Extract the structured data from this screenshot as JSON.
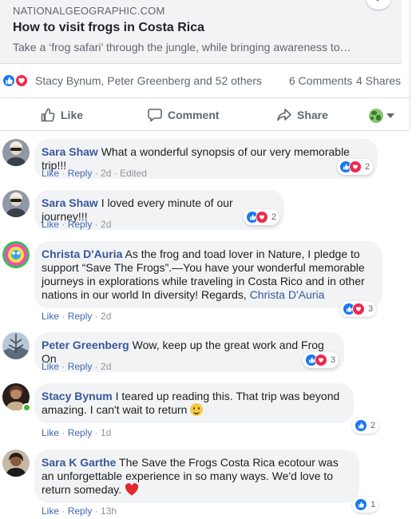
{
  "link_preview": {
    "domain": "NATIONALGEOGRAPHIC.COM",
    "title": "How to visit frogs in Costa Rica",
    "description": "Take a ‘frog safari’ through the jungle, while bringing awareness to…"
  },
  "reactions_summary": {
    "names": "Stacy Bynum, Peter Greenberg and 52 others",
    "comments": "6 Comments",
    "shares": "4 Shares",
    "icons": [
      "like-icon",
      "love-icon"
    ]
  },
  "actions": {
    "like": "Like",
    "comment": "Comment",
    "share": "Share"
  },
  "comments": [
    {
      "name": "Sara Shaw",
      "text": "What a wonderful synopsis of our very memorable trip!!!",
      "like": "Like",
      "reply": "Reply",
      "time": "2d",
      "edited": "Edited",
      "reaction_count": "2",
      "reactions": [
        "like",
        "love"
      ]
    },
    {
      "name": "Sara Shaw",
      "text": "I loved every minute of our journey!!!",
      "like": "Like",
      "reply": "Reply",
      "time": "2d",
      "reaction_count": "2",
      "reactions": [
        "like",
        "love"
      ]
    },
    {
      "name": "Christa D'Auria",
      "text": "As the frog and toad lover in Nature, I pledge to support “Save The Frogs”.—You have your wonderful memorable journeys in explorations while traveling in Costa Rico and in other nations in our world In diversity! Regards,",
      "mention": "Christa D'Auria",
      "like": "Like",
      "reply": "Reply",
      "time": "2d",
      "reaction_count": "3",
      "reactions": [
        "like",
        "love"
      ]
    },
    {
      "name": "Peter Greenberg",
      "text": "Wow, keep up the great work and Frog On",
      "like": "Like",
      "reply": "Reply",
      "time": "2d",
      "reaction_count": "3",
      "reactions": [
        "like",
        "love"
      ]
    },
    {
      "name": "Stacy Bynum",
      "text": "I teared up reading this. That trip was beyond amazing. I can't wait to return",
      "emoji": "smile",
      "like": "Like",
      "reply": "Reply",
      "time": "1d",
      "reaction_count": "2",
      "reactions": [
        "like"
      ]
    },
    {
      "name": "Sara K Garthe",
      "text": "The Save the Frogs Costa Rica ecotour was an unforgettable experience in so many ways. We'd love to return someday.",
      "emoji": "heart",
      "like": "Like",
      "reply": "Reply",
      "time": "13h",
      "reaction_count": "1",
      "reactions": [
        "like"
      ]
    }
  ],
  "colors": {
    "link_blue": "#385898",
    "meta_blue": "#4267b2",
    "like_blue": "#1877f2",
    "love_red": "#f0284a",
    "bubble_bg": "#f2f3f5",
    "muted_text": "#606770"
  }
}
